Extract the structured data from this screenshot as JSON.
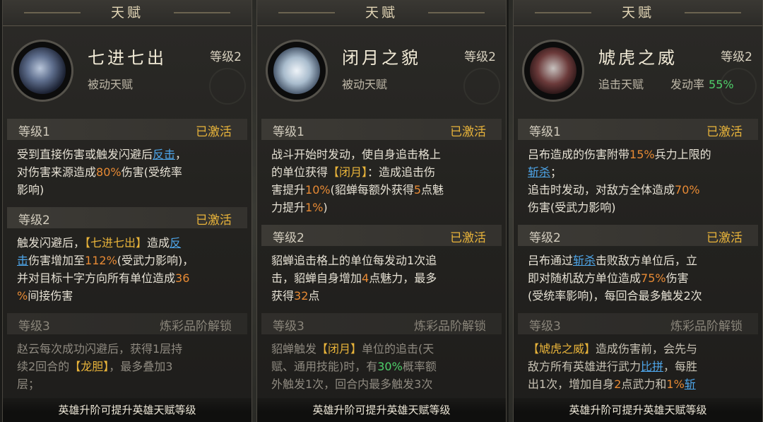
{
  "panels": [
    {
      "header": "天赋",
      "name": "七进七出",
      "level": "等级2",
      "type": "被动天赋",
      "levels": [
        {
          "label": "等级1",
          "state": "已激活"
        },
        {
          "label": "等级2",
          "state": "已激活"
        },
        {
          "label": "等级3",
          "state": "炼彩品阶解锁"
        }
      ],
      "desc1": [
        "受到直接伤害或触发闪避后",
        "反击",
        "，",
        "对伤害来源造成",
        "80%",
        "伤害(受统率",
        "影响)"
      ],
      "desc2": [
        "触发闪避后，",
        "【七进七出】",
        "造成",
        "反",
        "击",
        "伤害增加至",
        "112%",
        "(受武力影响)，",
        "并对目标十字方向所有单位造成",
        "36",
        "%",
        "间接伤害"
      ],
      "desc3": [
        "赵云每次成功闪避后，获得1层持",
        "续2回合的",
        "【龙胆】",
        "，最多叠加3",
        "层；"
      ],
      "footer": "英雄升阶可提升英雄天赋等级"
    },
    {
      "header": "天赋",
      "name": "闭月之貌",
      "level": "等级2",
      "type": "被动天赋",
      "levels": [
        {
          "label": "等级1",
          "state": "已激活"
        },
        {
          "label": "等级2",
          "state": "已激活"
        },
        {
          "label": "等级3",
          "state": "炼彩品阶解锁"
        }
      ],
      "desc1": [
        "战斗开始时发动，使自身追击格上",
        "的单位获得",
        "【闭月】",
        "：造成追击伤",
        "害提升",
        "10%",
        "(貂蝉每额外获得",
        "5",
        "点魅",
        "力提升",
        "1%",
        ")"
      ],
      "desc2": [
        "貂蝉追击格上的单位每发动1次追",
        "击，貂蝉自身增加",
        "4",
        "点魅力，最多",
        "获得",
        "32",
        "点"
      ],
      "desc3": [
        "貂蝉触发",
        "【闭月】",
        "单位的追击(天",
        "赋、通用技能)时，有",
        "30%",
        "概率额",
        "外触发1次，回合内最多触发3次"
      ],
      "footer": "英雄升阶可提升英雄天赋等级"
    },
    {
      "header": "天赋",
      "name": "虓虎之威",
      "level": "等级2",
      "type": "追击天赋",
      "proc_label": "发动率",
      "proc_value": "55%",
      "levels": [
        {
          "label": "等级1",
          "state": "已激活"
        },
        {
          "label": "等级2",
          "state": "已激活"
        },
        {
          "label": "等级3",
          "state": "炼彩品阶解锁"
        }
      ],
      "desc1": [
        "吕布造成的伤害附带",
        "15%",
        "兵力上限的",
        "斩杀",
        "；",
        "追击时发动，对敌方全体造成",
        "70%",
        "伤害(受武力影响)"
      ],
      "desc2": [
        "吕布通过",
        "斩杀",
        "击败敌方单位后，立",
        "即对随机敌方单位造成",
        "75%",
        "伤害",
        "(受统率影响)，每回合最多触发2次"
      ],
      "desc3": [
        "【虓虎之威】",
        "造成伤害前，会先与",
        "敌方所有英雄进行武力",
        "比拼",
        "，每胜",
        "出1次，增加自身",
        "2",
        "点武力和",
        "1%",
        "斩"
      ],
      "footer": "英雄升阶可提升英雄天赋等级"
    }
  ],
  "colors": {
    "active": "#e9b43a",
    "value": "#e78a34",
    "keyword": "#4ea6ea",
    "proc_rate": "#4fd06a"
  }
}
